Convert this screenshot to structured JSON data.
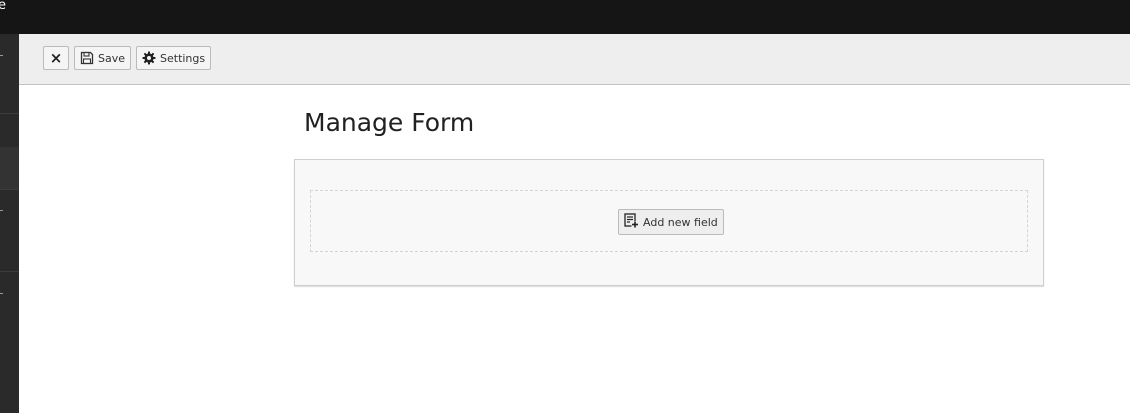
{
  "topbar": {
    "fragment": "e"
  },
  "toolbar": {
    "close_label": "×",
    "save_label": "Save",
    "settings_label": "Settings"
  },
  "main": {
    "title": "Manage Form",
    "add_field_label": "Add new field"
  },
  "icons": {
    "close": "close-icon",
    "save": "floppy-disk-icon",
    "settings": "gear-icon",
    "add_field": "add-field-icon"
  },
  "colors": {
    "topbar": "#151515",
    "sidebar": "#2a2a2a",
    "docheader": "#eeeeee",
    "panel": "#f8f8f8"
  }
}
